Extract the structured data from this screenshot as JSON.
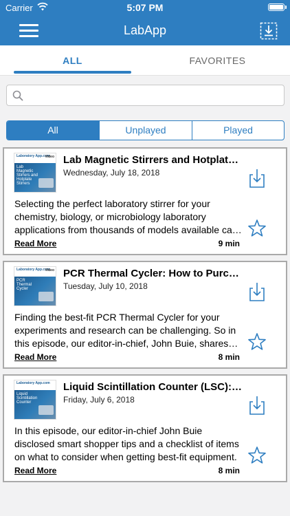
{
  "status_bar": {
    "carrier": "Carrier",
    "time": "5:07 PM"
  },
  "nav": {
    "title": "LabApp",
    "menu_icon": "hamburger-menu-icon",
    "download_icon": "download-manager-icon"
  },
  "tabs": [
    {
      "label": "ALL",
      "active": true
    },
    {
      "label": "FAVORITES",
      "active": false
    }
  ],
  "search": {
    "placeholder": "",
    "value": ""
  },
  "segments": [
    {
      "label": "All",
      "selected": true
    },
    {
      "label": "Unplayed"
    },
    {
      "label": "Played"
    }
  ],
  "accent_color": "#2e7ec1",
  "episodes": [
    {
      "title": "Lab Magnetic Stirrers and Hotplates: How to Purchase",
      "date": "Wednesday, July 18, 2018",
      "description": "Selecting the perfect laboratory stirrer for your chemistry, biology, or microbiology laboratory applications from thousands of models available can be challenging.",
      "read_more": "Read More",
      "duration": "9 min",
      "thumb": {
        "logo": "Laboratory App.com",
        "badge": "Video",
        "text": "Lab Magnetic Stirrers and Hotplate Stirrers"
      }
    },
    {
      "title": "PCR Thermal Cycler: How to Purchase",
      "date": "Tuesday, July 10, 2018",
      "description": "Finding the best-fit PCR Thermal Cycler for your experiments and research can be challenging. So in this episode, our editor-in-chief, John Buie, shares tips.",
      "read_more": "Read More",
      "duration": "8 min",
      "thumb": {
        "logo": "Laboratory App.com",
        "badge": "Video",
        "text": "PCR Thermal Cycler"
      }
    },
    {
      "title": "Liquid Scintillation Counter (LSC): How to Purchase",
      "date": "Friday, July 6, 2018",
      "description": "In this episode, our editor-in-chief John Buie disclosed smart shopper tips and a checklist of items on what to consider when getting best-fit equipment.",
      "read_more": "Read More",
      "duration": "8 min",
      "thumb": {
        "logo": "Laboratory App.com",
        "badge": "",
        "text": "Liquid Scintillation Counter"
      }
    }
  ]
}
